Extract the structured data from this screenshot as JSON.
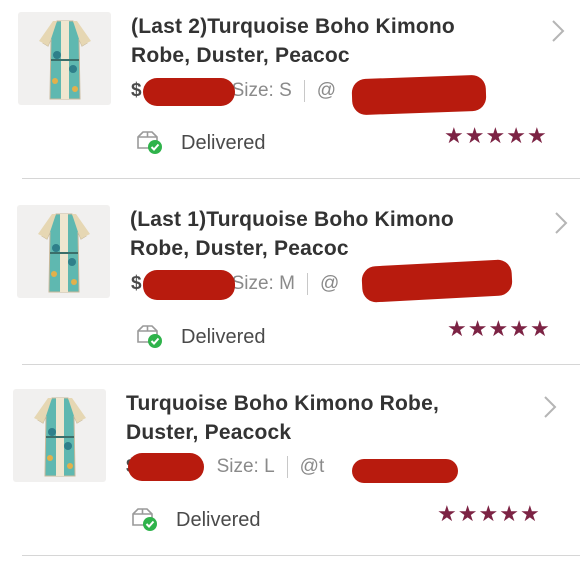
{
  "orders": [
    {
      "title_line1": "(Last 2)Turquoise Boho Kimono",
      "title_line2": "Robe, Duster, Peacoc",
      "price_prefix": "$",
      "size": "Size: S",
      "handle_prefix": "@",
      "status": "Delivered",
      "rating": 5
    },
    {
      "title_line1": "(Last 1)Turquoise Boho Kimono",
      "title_line2": "Robe, Duster, Peacoc",
      "price_prefix": "$",
      "size": "Size: M",
      "handle_prefix": "@",
      "status": "Delivered",
      "rating": 5
    },
    {
      "title_line1": "Turquoise Boho Kimono Robe,",
      "title_line2": "Duster, Peacock",
      "price_prefix": "$",
      "size": "Size: L",
      "handle_prefix": "@t",
      "status": "Delivered",
      "rating": 5
    }
  ],
  "icons": {
    "thumbnail": "kimono-product-thumbnail",
    "status": "delivered-box-check-icon",
    "chevron": "chevron-right-icon",
    "star": "star-icon"
  },
  "colors": {
    "star": "#7c2344",
    "check": "#2fb34b",
    "redaction": "#b81b0e"
  }
}
